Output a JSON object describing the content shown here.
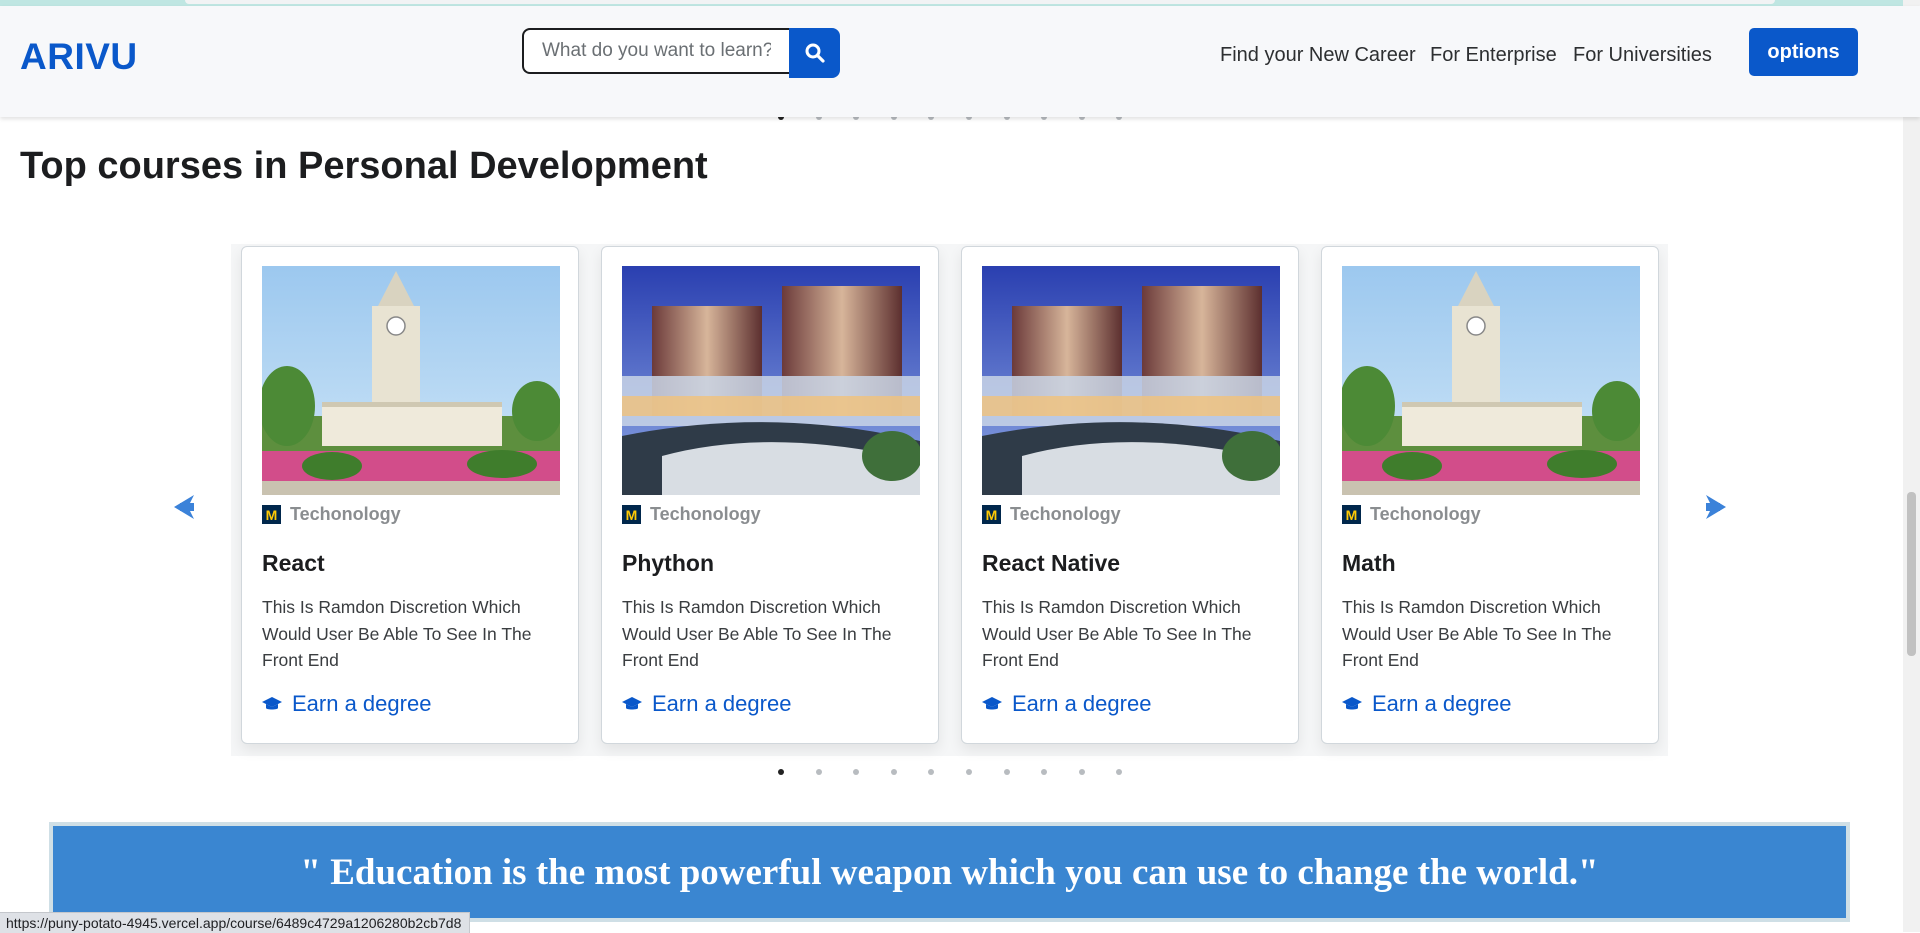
{
  "header": {
    "logo": "ARIVU",
    "search_placeholder": "What do you want to learn?",
    "nav": [
      "Find your New Career",
      "For Enterprise",
      "For Universities"
    ],
    "options_label": "options"
  },
  "section": {
    "title": "Top courses in Personal Development"
  },
  "carousel": {
    "active_dot": 1,
    "dot_count": 10,
    "cards": [
      {
        "category": "Techonology",
        "title": "React",
        "description": "This Is Ramdon Discretion Which Would User Be Able To See In The Front End",
        "cta": "Earn a degree",
        "image": "clock-tower"
      },
      {
        "category": "Techonology",
        "title": "Phython",
        "description": "This Is Ramdon Discretion Which Would User Be Able To See In The Front End",
        "cta": "Earn a degree",
        "image": "modern-building"
      },
      {
        "category": "Techonology",
        "title": "React Native",
        "description": "This Is Ramdon Discretion Which Would User Be Able To See In The Front End",
        "cta": "Earn a degree",
        "image": "modern-building"
      },
      {
        "category": "Techonology",
        "title": "Math",
        "description": "This Is Ramdon Discretion Which Would User Be Able To See In The Front End",
        "cta": "Earn a degree",
        "image": "clock-tower"
      }
    ]
  },
  "quote": {
    "text": "\" Education is the most powerful weapon which you can use to change the world.\""
  },
  "status_bar": {
    "url": "https://puny-potato-4945.vercel.app/course/6489c4729a1206280b2cb7d8"
  },
  "colors": {
    "primary": "#0a58ca",
    "quote_bg": "#3a86d1",
    "arrow": "#3b82d9"
  }
}
